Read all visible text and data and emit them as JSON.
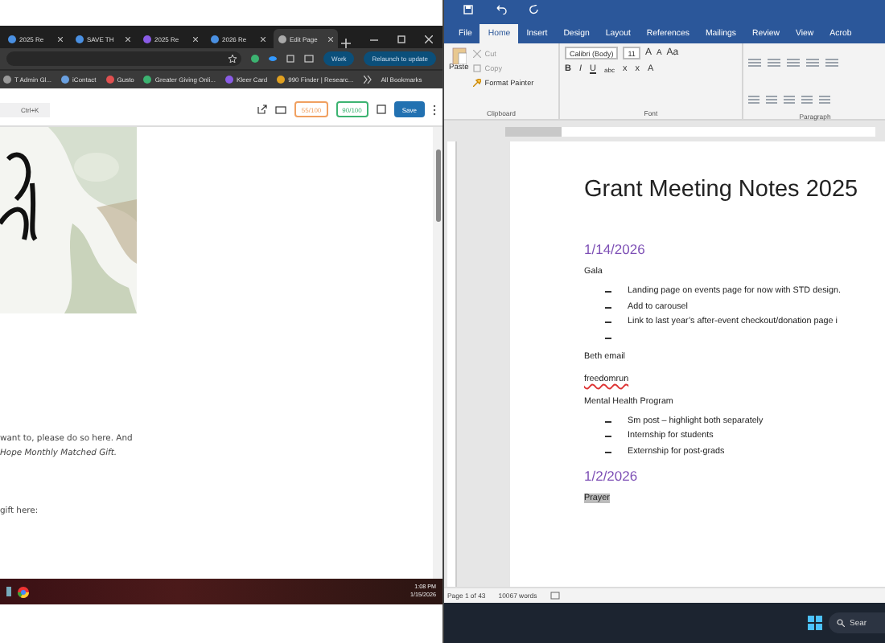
{
  "browser": {
    "tabs": [
      {
        "label": "2025 Re",
        "selected": false
      },
      {
        "label": "SAVE TH",
        "selected": false
      },
      {
        "label": "2025 Re",
        "selected": false
      },
      {
        "label": "2026 Re",
        "selected": false
      },
      {
        "label": "Edit Page",
        "selected": true
      }
    ],
    "profile": "Work",
    "update_button": "Relaunch to update",
    "bookmarks": [
      "T Admin Gl...",
      "iContact",
      "Gusto",
      "Greater Giving Onli...",
      "Kleer Card",
      "990 Finder | Researc..."
    ],
    "all_bookmarks": "All Bookmarks"
  },
  "editor": {
    "shortcut": "Ctrl+K",
    "scores": [
      {
        "label": "55/100",
        "color": "#f0a060"
      },
      {
        "label": "90/100",
        "color": "#3cb371"
      }
    ],
    "save": "Save",
    "paragraphs": [
      {
        "text": "want to, please do so here. And",
        "italic": false
      },
      {
        "text": "Hope Monthly Matched Gift.",
        "italic": true
      },
      {
        "text": "gift here:",
        "italic": false
      }
    ]
  },
  "taskbar_left": {
    "time": "1:08 PM",
    "date": "1/15/2026"
  },
  "word": {
    "tabs": [
      {
        "label": "File",
        "selected": false
      },
      {
        "label": "Home",
        "selected": true
      },
      {
        "label": "Insert",
        "selected": false
      },
      {
        "label": "Design",
        "selected": false
      },
      {
        "label": "Layout",
        "selected": false
      },
      {
        "label": "References",
        "selected": false
      },
      {
        "label": "Mailings",
        "selected": false
      },
      {
        "label": "Review",
        "selected": false
      },
      {
        "label": "View",
        "selected": false
      },
      {
        "label": "Acrob",
        "selected": false
      }
    ],
    "clipboard": {
      "paste": "Paste",
      "cut": "Cut",
      "copy": "Copy",
      "format_painter": "Format Painter",
      "label": "Clipboard"
    },
    "font": {
      "name": "Calibri (Body)",
      "size": "11",
      "buttons_top": [
        "A",
        "A",
        "Aa"
      ],
      "buttons_bottom": [
        "B",
        "I",
        "U",
        "abc",
        "x",
        "x",
        "A"
      ],
      "label": "Font"
    },
    "paragraph": {
      "label": "Paragraph"
    },
    "document": [
      {
        "kind": "title",
        "text": "Grant Meeting Notes 2025"
      },
      {
        "kind": "date",
        "text": "1/14/2026"
      },
      {
        "kind": "para",
        "text": "Gala"
      },
      {
        "kind": "bullet",
        "text": "Landing page on events page for now with STD design."
      },
      {
        "kind": "bullet",
        "text": "Add to carousel"
      },
      {
        "kind": "bullet",
        "text": "Link to last year’s after-event checkout/donation page i"
      },
      {
        "kind": "bullet"
      },
      {
        "kind": "para",
        "text": "Beth email"
      },
      {
        "kind": "spell",
        "text": "freedomrun"
      },
      {
        "kind": "para",
        "text": "Mental Health Program"
      },
      {
        "kind": "bullet",
        "text": "Sm post – highlight both separately"
      },
      {
        "kind": "bullet",
        "text": "Internship for students"
      },
      {
        "kind": "bullet",
        "text": "Externship for post-grads"
      },
      {
        "kind": "date",
        "text": "1/2/2026"
      },
      {
        "kind": "highlight",
        "text": "Prayer"
      }
    ],
    "status": {
      "page": "Page 1 of 43",
      "words": "10067 words"
    }
  },
  "taskbar_right": {
    "search": "Sear"
  }
}
